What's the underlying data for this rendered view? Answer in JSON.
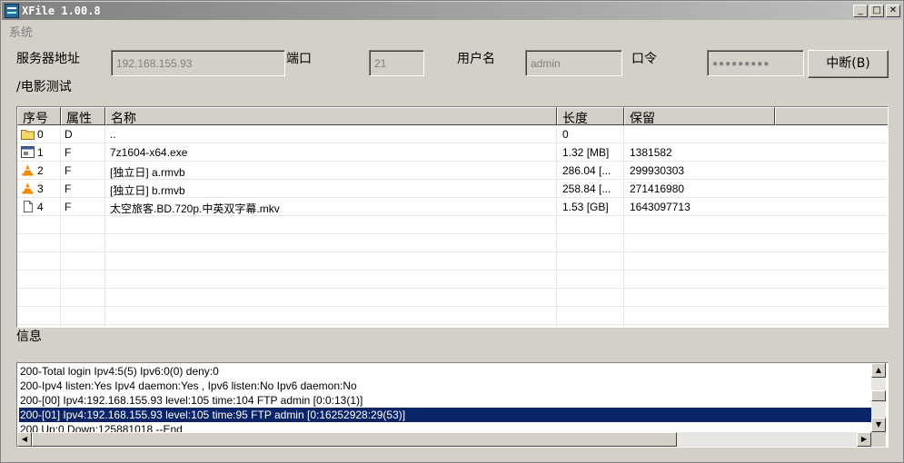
{
  "window": {
    "title": "XFile 1.00.8",
    "min_btn": "_",
    "max_btn": "□",
    "close_btn": "✕"
  },
  "menu": {
    "system": "系统"
  },
  "connection": {
    "server_label": "服务器地址",
    "server_value": "192.168.155.93",
    "port_label": "端口",
    "port_value": "21",
    "user_label": "用户名",
    "user_value": "admin",
    "password_label": "口令",
    "password_value": "●●●●●●●●●",
    "disconnect_btn": "中断(B)"
  },
  "path": "/电影测试",
  "file_list": {
    "columns": [
      "序号",
      "属性",
      "名称",
      "长度",
      "保留"
    ],
    "rows": [
      {
        "index": "0",
        "attr": "D",
        "name": "..",
        "length": "0",
        "reserved": "",
        "icon": "folder-icon"
      },
      {
        "index": "1",
        "attr": "F",
        "name": "7z1604-x64.exe",
        "length": "1.32 [MB]",
        "reserved": "1381582",
        "icon": "exe-icon"
      },
      {
        "index": "2",
        "attr": "F",
        "name": "[独立日] a.rmvb",
        "length": "286.04 [...",
        "reserved": "299930303",
        "icon": "vlc-icon"
      },
      {
        "index": "3",
        "attr": "F",
        "name": "[独立日] b.rmvb",
        "length": "258.84 [...",
        "reserved": "271416980",
        "icon": "vlc-icon"
      },
      {
        "index": "4",
        "attr": "F",
        "name": "太空旅客.BD.720p.中英双字幕.mkv",
        "length": "1.53 [GB]",
        "reserved": "1643097713",
        "icon": "file-icon"
      }
    ]
  },
  "info_label": "信息",
  "log": {
    "lines": [
      "200-Total login  Ipv4:5(5) Ipv6:0(0) deny:0",
      "200-Ipv4 listen:Yes Ipv4 daemon:Yes , Ipv6 listen:No Ipv6 daemon:No",
      "200-[00] Ipv4:192.168.155.93 level:105 time:104 FTP admin [0:0:13(1)]",
      "200-[01] Ipv4:192.168.155.93 level:105 time:95 FTP admin [0:16252928:29(53)]",
      "200 Up:0 Down:125881018 --End"
    ],
    "selected_index": 3
  },
  "colors": {
    "selection": "#0a246a",
    "face": "#d4d0c8"
  }
}
